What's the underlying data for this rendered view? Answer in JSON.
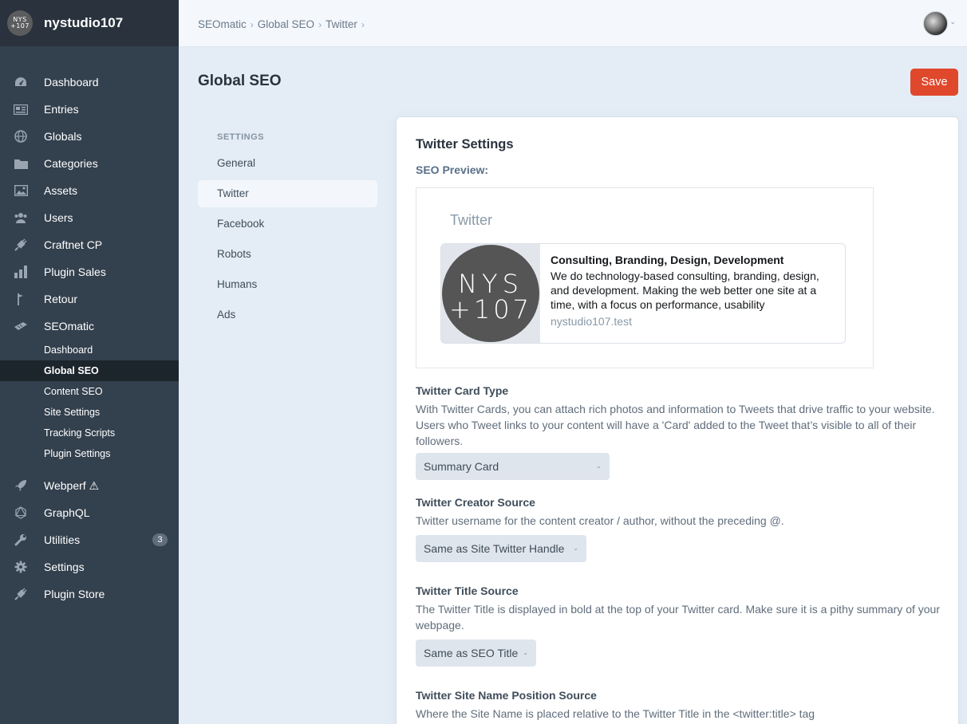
{
  "site": {
    "name": "nystudio107",
    "logo_text_top": "NYS",
    "logo_text_bottom": "+107"
  },
  "nav": {
    "items": [
      {
        "label": "Dashboard",
        "icon": "gauge-icon"
      },
      {
        "label": "Entries",
        "icon": "newspaper-icon"
      },
      {
        "label": "Globals",
        "icon": "globe-icon"
      },
      {
        "label": "Categories",
        "icon": "folder-icon"
      },
      {
        "label": "Assets",
        "icon": "image-icon"
      },
      {
        "label": "Users",
        "icon": "users-icon"
      },
      {
        "label": "Craftnet CP",
        "icon": "plug-icon"
      },
      {
        "label": "Plugin Sales",
        "icon": "bar-chart-icon"
      },
      {
        "label": "Retour",
        "icon": "signpost-icon"
      },
      {
        "label": "SEOmatic",
        "icon": "seomatic-icon"
      }
    ],
    "seomatic_sub": [
      {
        "label": "Dashboard"
      },
      {
        "label": "Global SEO"
      },
      {
        "label": "Content SEO"
      },
      {
        "label": "Site Settings"
      },
      {
        "label": "Tracking Scripts"
      },
      {
        "label": "Plugin Settings"
      }
    ],
    "items_after": [
      {
        "label": "Webperf ⚠",
        "icon": "rocket-icon"
      },
      {
        "label": "GraphQL",
        "icon": "graphql-icon"
      },
      {
        "label": "Utilities",
        "icon": "wrench-icon",
        "badge": "3"
      },
      {
        "label": "Settings",
        "icon": "gear-icon"
      },
      {
        "label": "Plugin Store",
        "icon": "plug-icon"
      }
    ]
  },
  "breadcrumb": [
    "SEOmatic",
    "Global SEO",
    "Twitter"
  ],
  "page": {
    "title": "Global SEO",
    "save_label": "Save"
  },
  "subnav": {
    "heading": "SETTINGS",
    "items": [
      "General",
      "Twitter",
      "Facebook",
      "Robots",
      "Humans",
      "Ads"
    ]
  },
  "content": {
    "title": "Twitter Settings",
    "preview_label": "SEO Preview:",
    "preview": {
      "heading": "Twitter",
      "card_title": "Consulting, Branding, Design, Development",
      "card_desc": "We do technology-based consulting, branding, design, and development. Making the web better one site at a time, with a focus on performance, usability",
      "card_domain": "nystudio107.test",
      "image_text_top": "NYS",
      "image_text_bottom": "+107"
    },
    "fields": {
      "card_type": {
        "heading": "Twitter Card Type",
        "desc": "With Twitter Cards, you can attach rich photos and information to Tweets that drive traffic to your website. Users who Tweet links to your content will have a 'Card' added to the Tweet that’s visible to all of their followers.",
        "value": "Summary Card"
      },
      "creator_source": {
        "heading": "Twitter Creator Source",
        "desc": "Twitter username for the content creator / author, without the preceding @.",
        "value": "Same as Site Twitter Handle"
      },
      "title_source": {
        "heading": "Twitter Title Source",
        "desc": "The Twitter Title is displayed in bold at the top of your Twitter card. Make sure it is a pithy summary of your webpage.",
        "value": "Same as SEO Title"
      },
      "site_name_position": {
        "heading": "Twitter Site Name Position Source",
        "desc": "Where the Site Name is placed relative to the Twitter Title in the <twitter:title> tag"
      }
    }
  }
}
